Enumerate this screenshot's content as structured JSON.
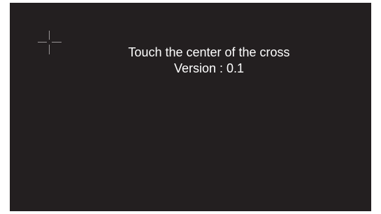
{
  "calibration": {
    "instruction": "Touch the center of the cross",
    "version_text": "Version : 0.1",
    "target_icon": "crosshair-icon"
  },
  "colors": {
    "background": "#231f20",
    "text": "#ffffff",
    "crosshair": "#9a9697"
  }
}
